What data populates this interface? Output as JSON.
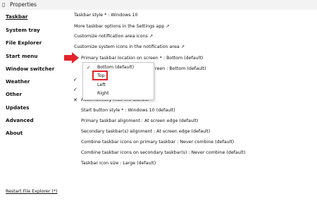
{
  "window": {
    "title": "Properties"
  },
  "sidebar": {
    "items": [
      {
        "label": "Taskbar",
        "active": true
      },
      {
        "label": "System tray"
      },
      {
        "label": "File Explorer"
      },
      {
        "label": "Start menu"
      },
      {
        "label": "Window switcher"
      },
      {
        "label": "Weather"
      },
      {
        "label": "Other"
      },
      {
        "label": "Updates"
      },
      {
        "label": "Advanced"
      },
      {
        "label": "About"
      }
    ],
    "restart_link": "Restart File Explorer (*)"
  },
  "options": {
    "taskbar_style": "Taskbar style * : Windows 10",
    "more_settings": "More taskbar options in the Settings app ↗",
    "customize_notif": "Customize notification area icons ↗",
    "customize_sys": "Customize system icons in the notification area ↗",
    "primary_location": "Primary taskbar location on screen * : Bottom (default)",
    "secondary_location_partial": "reen : Bottom (default)",
    "auto_hide": "Automatically hide the taskbar",
    "start_button": "Start button style * : Windows 10 (default)",
    "primary_alignment": "Primary taskbar alignment : At screen edge (default)",
    "secondary_alignment": "Secondary taskbar(s) alignment : At screen edge (default)",
    "combine_primary": "Combine taskbar icons on primary taskbar : Never combine (default)",
    "combine_secondary": "Combine taskbar icons on secondary taskbar(s) : Never combine (default)",
    "icon_size": "Taskbar icon size : Large (default)"
  },
  "checks": {
    "check_mark": "✓",
    "cross_mark": "✕"
  },
  "dropdown": {
    "items": [
      "Bottom (default)",
      "Top",
      "Left",
      "Right"
    ],
    "selected_check": "✓"
  },
  "colors": {
    "highlight": "#e3242b"
  }
}
